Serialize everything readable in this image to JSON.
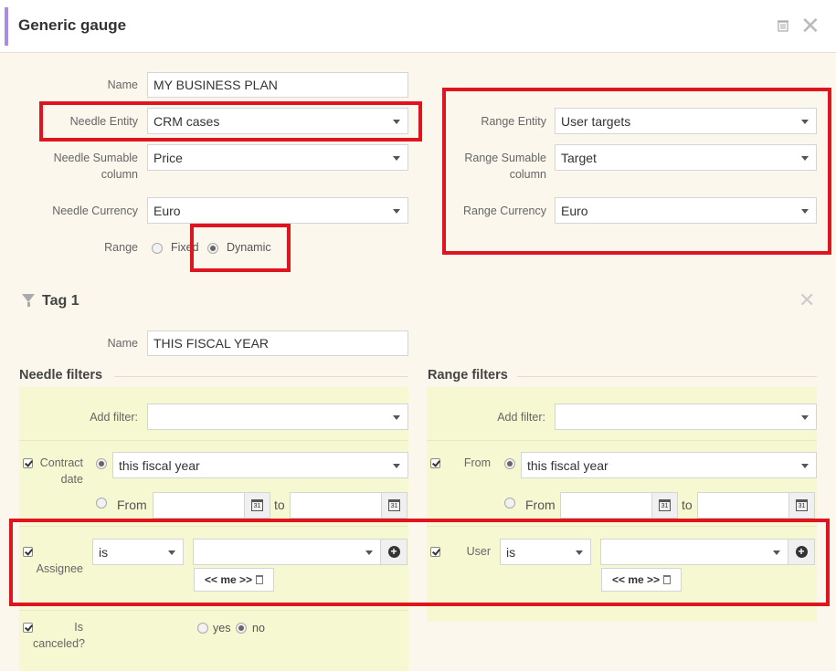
{
  "window": {
    "title": "Generic gauge"
  },
  "needle": {
    "name_label": "Name",
    "name_value": "MY BUSINESS PLAN",
    "entity_label": "Needle Entity",
    "entity_value": "CRM cases",
    "sumable_label_1": "Needle Sumable",
    "sumable_label_2": "column",
    "sumable_value": "Price",
    "currency_label": "Needle Currency",
    "currency_value": "Euro",
    "range_label": "Range",
    "range_fixed": "Fixed",
    "range_dynamic": "Dynamic"
  },
  "range": {
    "entity_label": "Range Entity",
    "entity_value": "User targets",
    "sumable_label_1": "Range Sumable",
    "sumable_label_2": "column",
    "sumable_value": "Target",
    "currency_label": "Range Currency",
    "currency_value": "Euro"
  },
  "tag": {
    "title": "Tag 1",
    "name_label": "Name",
    "name_value": "THIS FISCAL YEAR"
  },
  "needle_filters": {
    "title": "Needle filters",
    "add_filter_label": "Add filter:",
    "contract_label_1": "Contract",
    "contract_label_2": "date",
    "period_value": "this fiscal year",
    "from_label": "From",
    "to_label": "to",
    "assignee_label": "Assignee",
    "assignee_op": "is",
    "me_chip": "<< me >>",
    "canceled_label_1": "Is",
    "canceled_label_2": "canceled?",
    "yes_label": "yes",
    "no_label": "no"
  },
  "range_filters": {
    "title": "Range filters",
    "add_filter_label": "Add filter:",
    "from_label": "From",
    "period_value": "this fiscal year",
    "from_label_2": "From",
    "to_label": "to",
    "user_label": "User",
    "user_op": "is",
    "me_chip": "<< me >>"
  },
  "colors": {
    "accent": "#a98ee0",
    "highlight": "#e0141e",
    "panel": "#f6f8d2",
    "background": "#fbf7ec"
  }
}
